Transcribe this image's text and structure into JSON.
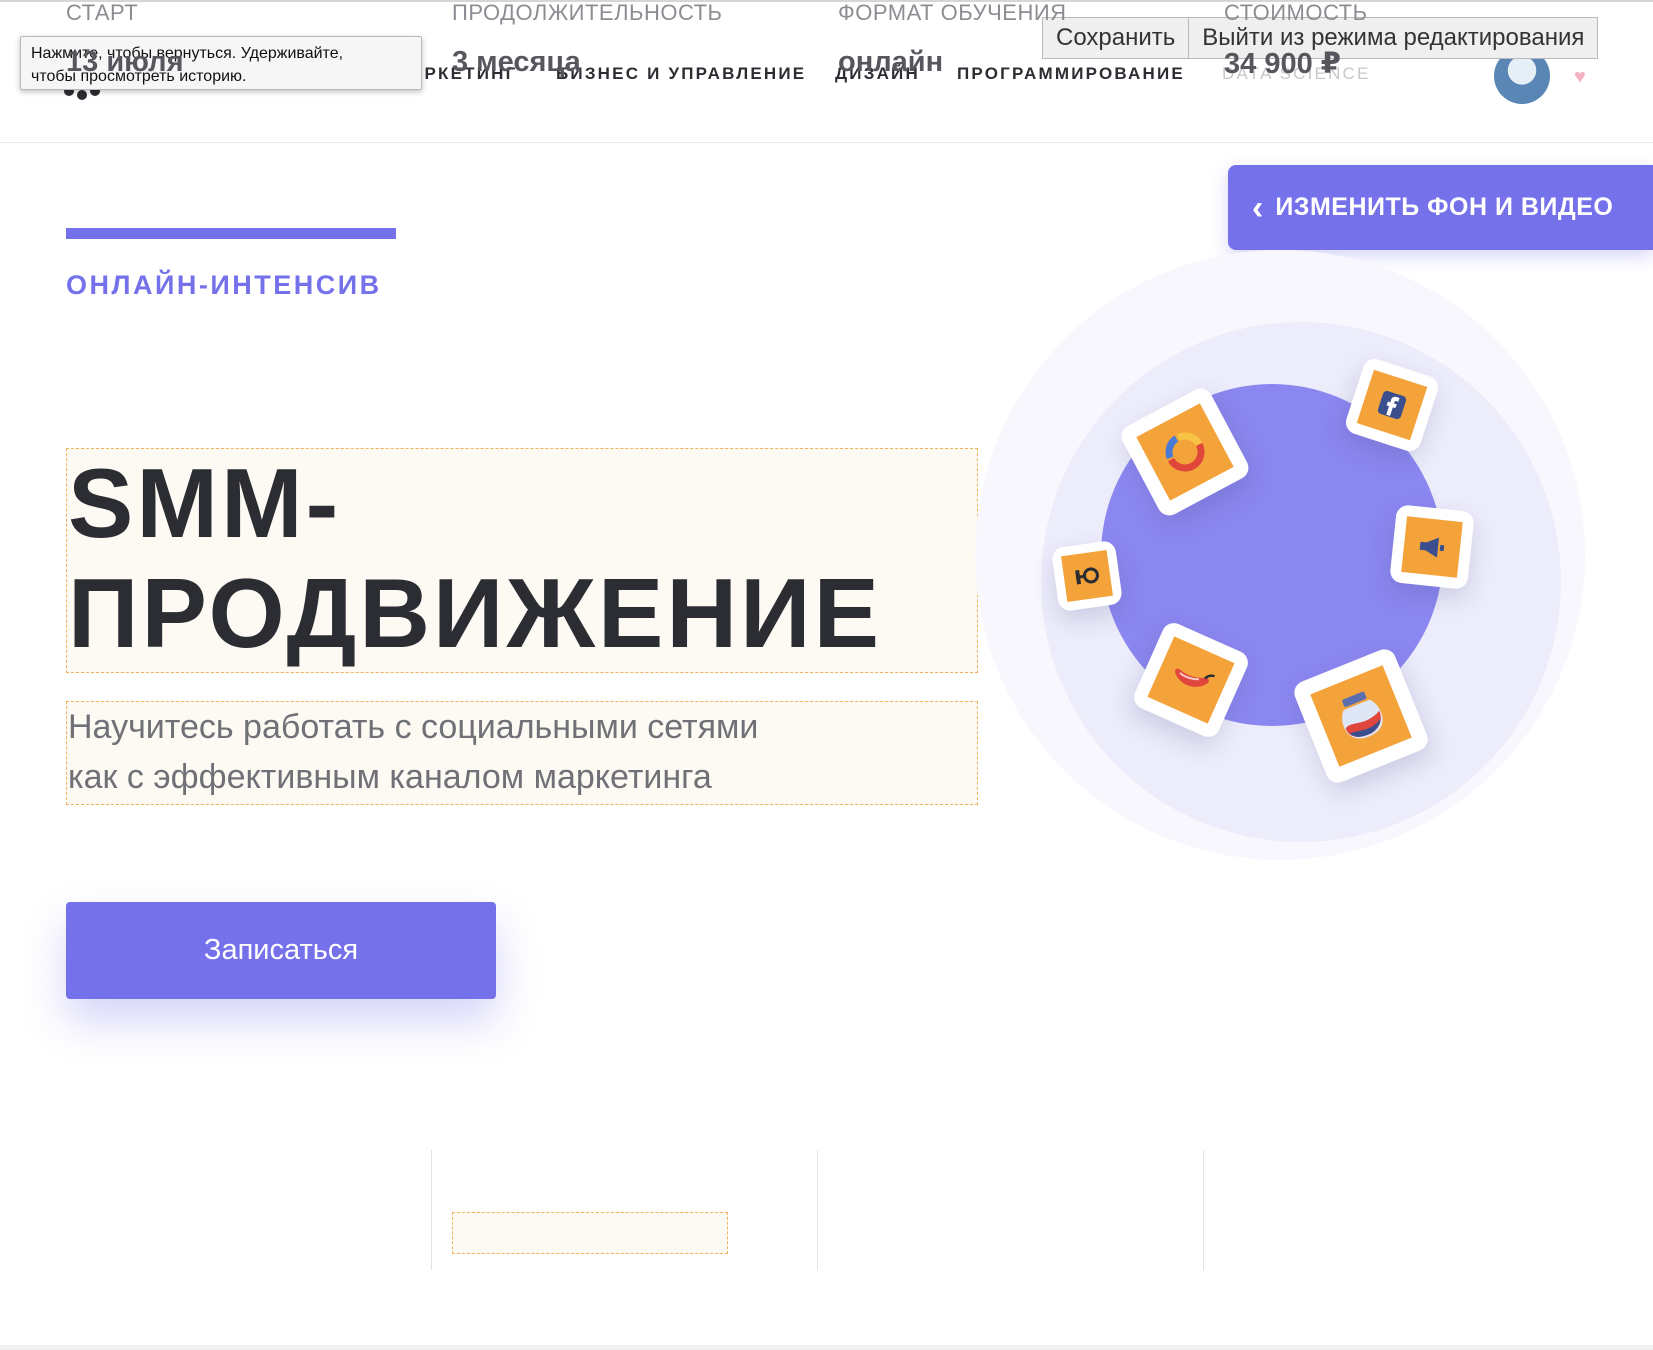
{
  "header": {
    "nav": [
      "АРКЕТИНГ",
      "БИЗНЕС И УПРАВЛЕНИЕ",
      "ДИЗАЙН",
      "ПРОГРАММИРОВАНИЕ",
      "DATA SCIENCE"
    ],
    "avatar_icon": "user-avatar",
    "favorite_icon": "heart-icon"
  },
  "editor": {
    "save_label": "Сохранить",
    "exit_label": "Выйти из режима редактирования",
    "tooltip_line1": "Нажмите, чтобы вернуться. Удерживайте,",
    "tooltip_line2": "чтобы просмотреть историю.",
    "change_bg_label": "ИЗМЕНИТЬ ФОН И ВИДЕО"
  },
  "hero": {
    "eyebrow": "ОНЛАЙН-ИНТЕНСИВ",
    "title_line1": "SMM-",
    "title_line2": "ПРОДВИЖЕНИЕ",
    "subtitle_line1": "Научитесь работать с социальными сетями",
    "subtitle_line2": "как с эффективным каналом маркетинга",
    "cta_label": "Записаться",
    "accent_color": "#7571ea",
    "tile_color": "#f4a33b",
    "tile_icons": [
      "analytics-donut-icon",
      "facebook-icon",
      "megaphone-icon",
      "yula-icon",
      "chili-pepper-icon",
      "jar-icon"
    ]
  },
  "stats": [
    {
      "label": "СТАРТ",
      "value": "13 июля"
    },
    {
      "label": "ПРОДОЛЖИТЕЛЬНОСТЬ",
      "value": "3 месяца"
    },
    {
      "label": "ФОРМАТ ОБУЧЕНИЯ",
      "value": "онлайн"
    },
    {
      "label": "СТОИМОСТЬ",
      "value": "34 900 ₽"
    }
  ]
}
